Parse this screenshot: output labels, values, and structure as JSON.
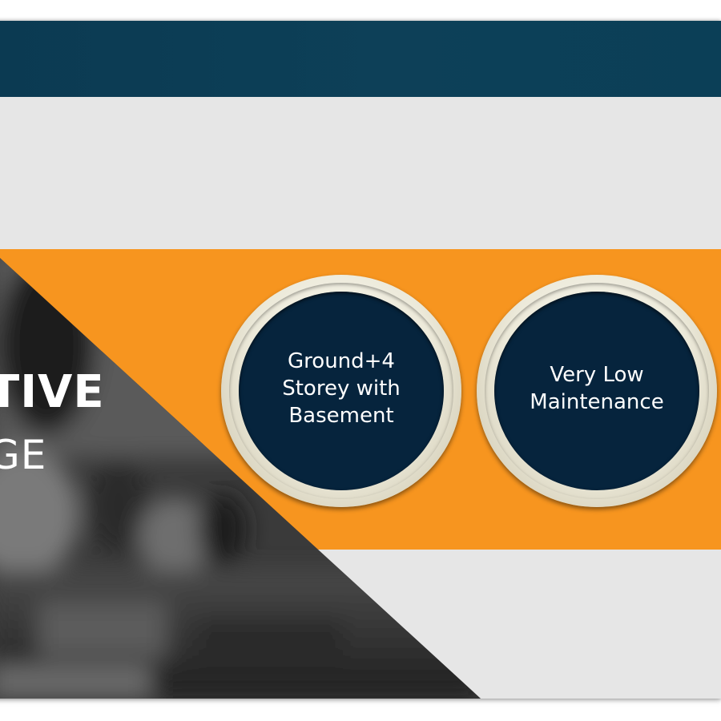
{
  "hero": {
    "line1": "TIVE",
    "line2": "GE"
  },
  "features": [
    {
      "label": "Ground+4 Storey with Basement"
    },
    {
      "label": "Very Low Maintenance"
    }
  ],
  "colors": {
    "header": "#0d4058",
    "accent": "#f7951f",
    "background": "#e6e6e6",
    "badge_fill": "#06243d",
    "badge_ring": "#ece9d9",
    "text": "#ffffff"
  }
}
